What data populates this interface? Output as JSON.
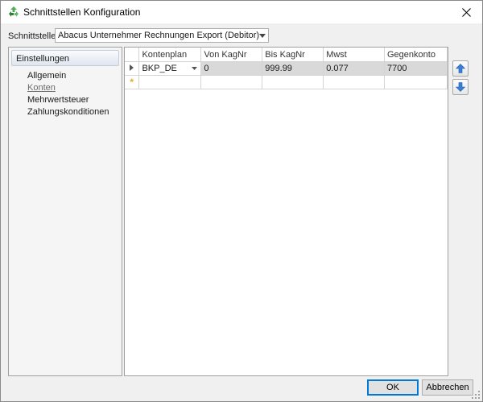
{
  "window": {
    "title": "Schnittstellen Konfiguration",
    "app_icon": "recycle-arrows-icon",
    "close_icon": "close-icon"
  },
  "interface": {
    "label": "Schnittstelle",
    "selected": "Abacus Unternehmer Rechnungen Export (Debitor)"
  },
  "sidebar": {
    "header": "Einstellungen",
    "items": [
      {
        "label": "Allgemein",
        "active": false
      },
      {
        "label": "Konten",
        "active": true
      },
      {
        "label": "Mehrwertsteuer",
        "active": false
      },
      {
        "label": "Zahlungskonditionen",
        "active": false
      }
    ]
  },
  "grid": {
    "columns": [
      "Kontenplan",
      "Von KagNr",
      "Bis KagNr",
      "Mwst",
      "Gegenkonto"
    ],
    "rows": [
      {
        "kontenplan": "BKP_DE",
        "von": "0",
        "bis": "999.99",
        "mwst": "0.077",
        "gegenkonto": "7700"
      }
    ],
    "new_row_marker": "*"
  },
  "move_buttons": {
    "up_icon": "arrow-up-icon",
    "down_icon": "arrow-down-icon"
  },
  "footer": {
    "ok_label": "OK",
    "cancel_label": "Abbrechen"
  },
  "colors": {
    "accent": "#0078d7",
    "selected_row": "#d9d9d9",
    "new_row_marker": "#e8a33d",
    "arrow_blue": "#3a7fd5"
  }
}
